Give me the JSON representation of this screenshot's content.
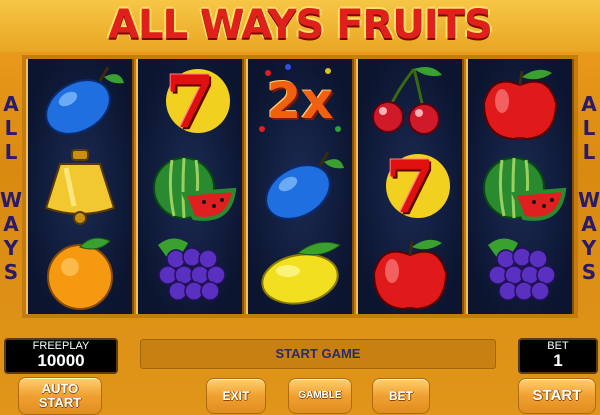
{
  "game": {
    "title": "ALL WAYS FRUITS"
  },
  "side_text": [
    "A",
    "L",
    "L",
    "",
    "W",
    "A",
    "Y",
    "S"
  ],
  "reels": [
    [
      "plum",
      "bell",
      "orange"
    ],
    [
      "seven",
      "watermelon",
      "grapes"
    ],
    [
      "2x-multiplier",
      "plum",
      "lemon"
    ],
    [
      "cherries",
      "seven",
      "apple"
    ],
    [
      "apple",
      "watermelon",
      "grapes"
    ]
  ],
  "multiplier_symbol_text": "2x",
  "seven_symbol_text": "7",
  "freeplay": {
    "label": "FREEPLAY",
    "value": "10000"
  },
  "bet": {
    "label": "BET",
    "value": "1"
  },
  "message": "START GAME",
  "buttons": {
    "auto_start_line1": "AUTO",
    "auto_start_line2": "START",
    "exit": "EXIT",
    "gamble": "GAMBLE",
    "bet": "BET",
    "start": "START"
  },
  "colors": {
    "title_red": "#e0201a",
    "reel_bg": "#0b1530",
    "gold": "#f0a020",
    "side_text": "#2a1a6a"
  }
}
